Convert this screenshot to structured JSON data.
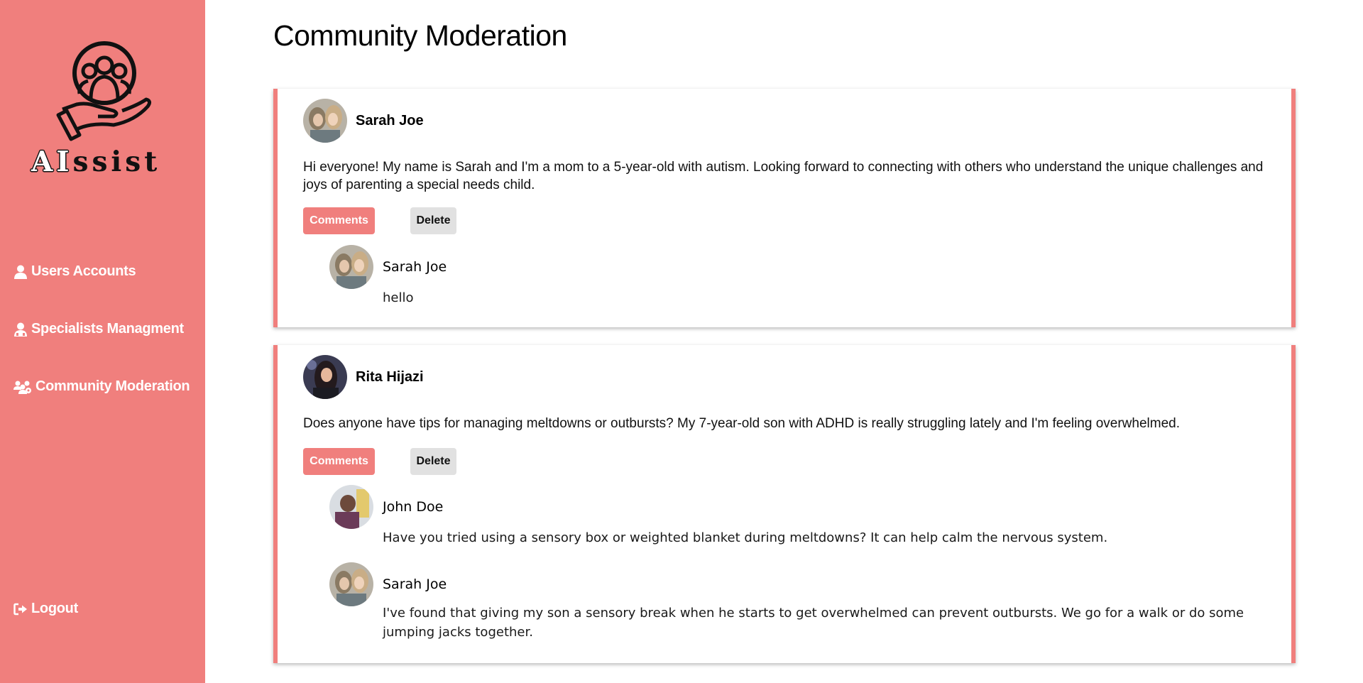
{
  "app": {
    "brand": "AIssist",
    "brand_part1": "AI",
    "brand_part2": "ssist"
  },
  "sidebar": {
    "items": [
      {
        "label": "Users Accounts",
        "icon": "user-icon"
      },
      {
        "label": "Specialists Managment",
        "icon": "specialist-icon"
      },
      {
        "label": "Community Moderation",
        "icon": "users-group-icon"
      }
    ],
    "logout_label": "Logout",
    "logout_icon": "logout-icon"
  },
  "page": {
    "title": "Community Moderation"
  },
  "posts": [
    {
      "author": "Sarah Joe",
      "text": "Hi everyone! My name is Sarah and I'm a mom to a 5-year-old with autism. Looking forward to connecting with others who understand the unique challenges and joys of parenting a special needs child.",
      "comments_label": "Comments",
      "delete_label": "Delete",
      "comments": [
        {
          "author": "Sarah Joe",
          "text": "hello"
        }
      ]
    },
    {
      "author": "Rita Hijazi",
      "text": "Does anyone have tips for managing meltdowns or outbursts? My 7-year-old son with ADHD is really struggling lately and I'm feeling overwhelmed.",
      "comments_label": "Comments",
      "delete_label": "Delete",
      "comments": [
        {
          "author": "John Doe",
          "text": "Have you tried using a sensory box or weighted blanket during meltdowns? It can help calm the nervous system."
        },
        {
          "author": "Sarah Joe",
          "text": "I've found that giving my son a sensory break when he starts to get overwhelmed can prevent outbursts. We go for a walk or do some jumping jacks together."
        }
      ]
    }
  ],
  "colors": {
    "accent": "#f07f7d",
    "delete_button": "#e1e1e1"
  }
}
